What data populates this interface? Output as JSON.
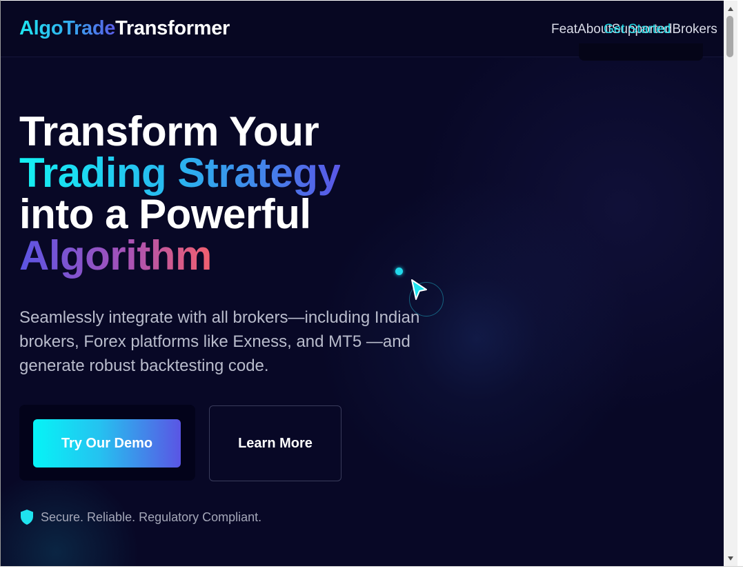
{
  "brand": {
    "part1": "AlgoTrade",
    "part2": "Transformer"
  },
  "nav": {
    "overlapping_text": "FeatAboutSupportedBrokers",
    "cta_overlay": "Get Started",
    "visible_overlap_render": "Feat Support Get Started Brokers"
  },
  "hero": {
    "title_line1": "Transform Your",
    "title_line2": "Trading Strategy",
    "title_line3": "into a Powerful",
    "title_line4": "Algorithm",
    "subtitle": "Seamlessly integrate with all brokers—including Indian brokers, Forex platforms like Exness, and MT5 —and generate robust backtesting code.",
    "primary_button": "Try Our Demo",
    "secondary_button": "Learn More",
    "trust_text": "Secure. Reliable. Regulatory Compliant."
  },
  "colors": {
    "background": "#080826",
    "accent_cyan": "#14f1f3",
    "accent_indigo": "#5a57e6",
    "accent_coral": "#f2606e"
  },
  "icons": {
    "trust": "shield-icon",
    "cursor": "pointer-cursor-icon"
  }
}
